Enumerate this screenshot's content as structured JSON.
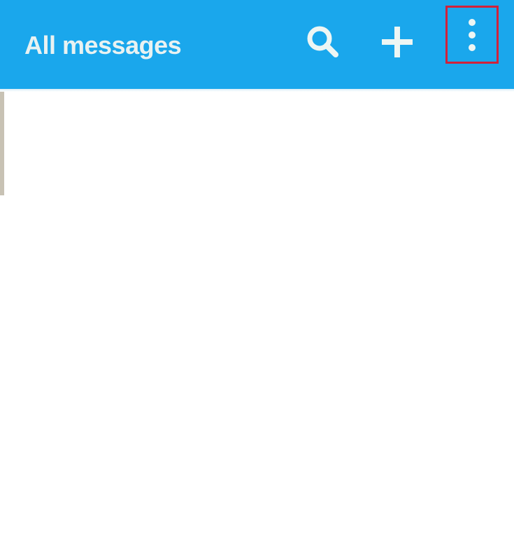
{
  "header": {
    "title": "All messages"
  },
  "icons": {
    "search": "search-icon",
    "add": "plus-icon",
    "more": "more-vertical-icon"
  },
  "colors": {
    "app_bar": "#1aa7ec",
    "title_text": "#e8f2f2",
    "highlight_box": "#d1213a"
  }
}
